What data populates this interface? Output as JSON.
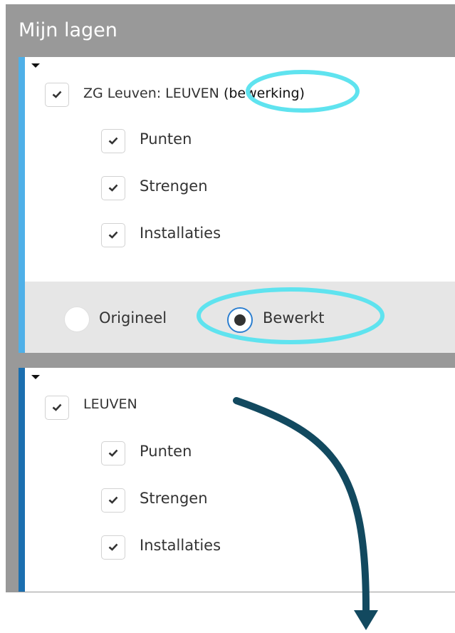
{
  "panel": {
    "title": "Mijn lagen"
  },
  "group1": {
    "layer_prefix": "ZG Leuven: LEUVEN",
    "layer_suffix": "(bewerking)",
    "children": [
      "Punten",
      "Strengen",
      "Installaties"
    ],
    "version": {
      "options": [
        "Origineel",
        "Bewerkt"
      ],
      "selected": "Bewerkt"
    }
  },
  "group2": {
    "layer": "LEUVEN",
    "children": [
      "Punten",
      "Strengen",
      "Installaties"
    ]
  },
  "colors": {
    "panel_bg": "#999999",
    "accent_light": "#4fb0e8",
    "accent_dark": "#1b6fb0",
    "highlight_circle": "#5fe3ef",
    "arrow": "#12495f"
  },
  "icons": [
    "caret-down-icon",
    "checkmark-icon",
    "radio-icon"
  ]
}
